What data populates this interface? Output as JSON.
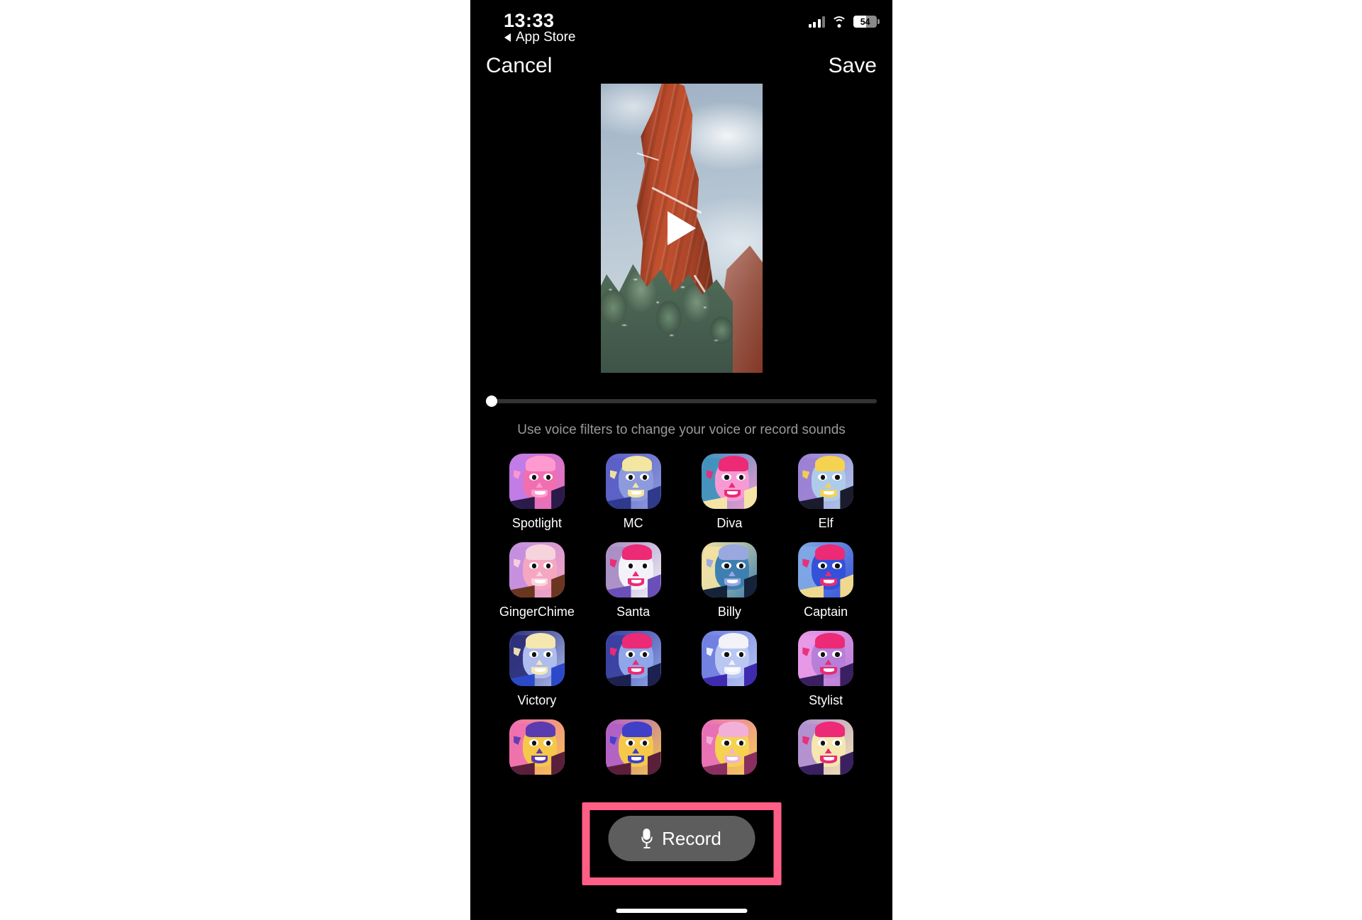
{
  "status_bar": {
    "time": "13:33",
    "battery_percent": "54",
    "signal_icon": "signal-bars-icon",
    "wifi_icon": "wifi-icon",
    "battery_icon": "battery-icon"
  },
  "back_link": {
    "label": "App Store",
    "icon": "back-triangle-icon"
  },
  "nav": {
    "cancel_label": "Cancel",
    "save_label": "Save"
  },
  "video_preview": {
    "play_icon": "play-triangle-icon",
    "description": "Red sandstone rock spire with snow covered evergreen trees under a cloudy sky"
  },
  "scrubber": {
    "handle_icon": "scrubber-handle-icon",
    "position_percent": 0
  },
  "hint": {
    "text": "Use voice filters to change your voice or record sounds"
  },
  "record_button": {
    "label": "Record",
    "icon": "microphone-icon"
  },
  "annotation": {
    "color": "#ff5f87",
    "target": "record-button"
  },
  "filters": {
    "rows": [
      [
        {
          "label": "Spotlight",
          "c1": "#c07ce8",
          "c2": "#f06fb0",
          "c3": "#ff9ad0",
          "c4": "#2b1b4a"
        },
        {
          "label": "MC",
          "c1": "#5b5fc7",
          "c2": "#8d9bdd",
          "c3": "#f2e6a0",
          "c4": "#2f3a8c"
        },
        {
          "label": "Diva",
          "c1": "#3f92bd",
          "c2": "#f79ad4",
          "c3": "#ec2a76",
          "c4": "#f5e3a8"
        },
        {
          "label": "Elf",
          "c1": "#9b7fd4",
          "c2": "#aeccea",
          "c3": "#f5d24f",
          "c4": "#1b1b2e"
        }
      ],
      [
        {
          "label": "GingerChime",
          "c1": "#c48fe0",
          "c2": "#f5a6c0",
          "c3": "#f7d3dd",
          "c4": "#6b3620"
        },
        {
          "label": "Santa",
          "c1": "#a88ec4",
          "c2": "#f2f2f8",
          "c3": "#ec2a76",
          "c4": "#6a4fb8"
        },
        {
          "label": "Billy",
          "c1": "#f3e2a4",
          "c2": "#3d7fb0",
          "c3": "#9aa8e0",
          "c4": "#14233a"
        },
        {
          "label": "Captain",
          "c1": "#7fa8e6",
          "c2": "#3551d8",
          "c3": "#ec2a76",
          "c4": "#f0d98f"
        }
      ],
      [
        {
          "label": "Victory",
          "c1": "#2c2f7a",
          "c2": "#aebcee",
          "c3": "#f5e7b0",
          "c4": "#2b49c9"
        },
        {
          "label": "",
          "c1": "#3a3f9e",
          "c2": "#8fa6e8",
          "c3": "#ec2a76",
          "c4": "#1d2150"
        },
        {
          "label": "",
          "c1": "#6f7fe0",
          "c2": "#b9c7f2",
          "c3": "#f2f2f8",
          "c4": "#3f2bb0"
        },
        {
          "label": "Stylist",
          "c1": "#e79ae8",
          "c2": "#b77fd8",
          "c3": "#ec2a76",
          "c4": "#3a2060"
        }
      ],
      [
        {
          "label": "",
          "c1": "#f06fb0",
          "c2": "#f5c84a",
          "c3": "#5b3bb0",
          "c4": "#5a1f3a"
        },
        {
          "label": "",
          "c1": "#b05fc8",
          "c2": "#f5c84a",
          "c3": "#3f3fc8",
          "c4": "#5a1f3a"
        },
        {
          "label": "",
          "c1": "#e86fb8",
          "c2": "#f5d24f",
          "c3": "#f2b0d8",
          "c4": "#8a2f60"
        },
        {
          "label": "",
          "c1": "#b08fd0",
          "c2": "#f5e7b0",
          "c3": "#ec2a76",
          "c4": "#3a2060"
        }
      ]
    ]
  }
}
